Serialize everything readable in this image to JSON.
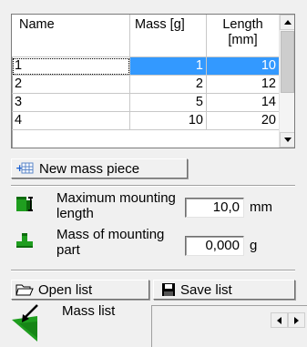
{
  "grid": {
    "columns": [
      "Name",
      "Mass [g]",
      "Length [mm]"
    ],
    "column_lines": [
      [
        "Name"
      ],
      [
        "Mass [g]"
      ],
      [
        "Length",
        "[mm]"
      ]
    ],
    "rows": [
      {
        "name": "1",
        "mass": "1",
        "length": "10"
      },
      {
        "name": "2",
        "mass": "2",
        "length": "12"
      },
      {
        "name": "3",
        "mass": "5",
        "length": "14"
      },
      {
        "name": "4",
        "mass": "10",
        "length": "20"
      }
    ],
    "selected_row": 0
  },
  "new_mass_button": {
    "label": "New mass piece",
    "icon": "table-add-icon"
  },
  "max_mounting": {
    "label_line1": "Maximum mounting",
    "label_line2": "length",
    "value": "10,0",
    "unit": "mm",
    "icon": "green-mount-length-icon"
  },
  "mass_mounting": {
    "label_line1": "Mass of mounting",
    "label_line2": "part",
    "value": "0,000",
    "unit": "g",
    "icon": "green-mount-part-icon"
  },
  "open_list_button": {
    "label": "Open list",
    "icon": "open-folder-icon"
  },
  "save_list_button": {
    "label": "Save list",
    "icon": "floppy-disk-icon"
  },
  "mass_list": {
    "label": "Mass list",
    "icon": "green-arrow-icon"
  },
  "colors": {
    "selection": "#3399ff",
    "accent_green": "#1f9e1f"
  }
}
